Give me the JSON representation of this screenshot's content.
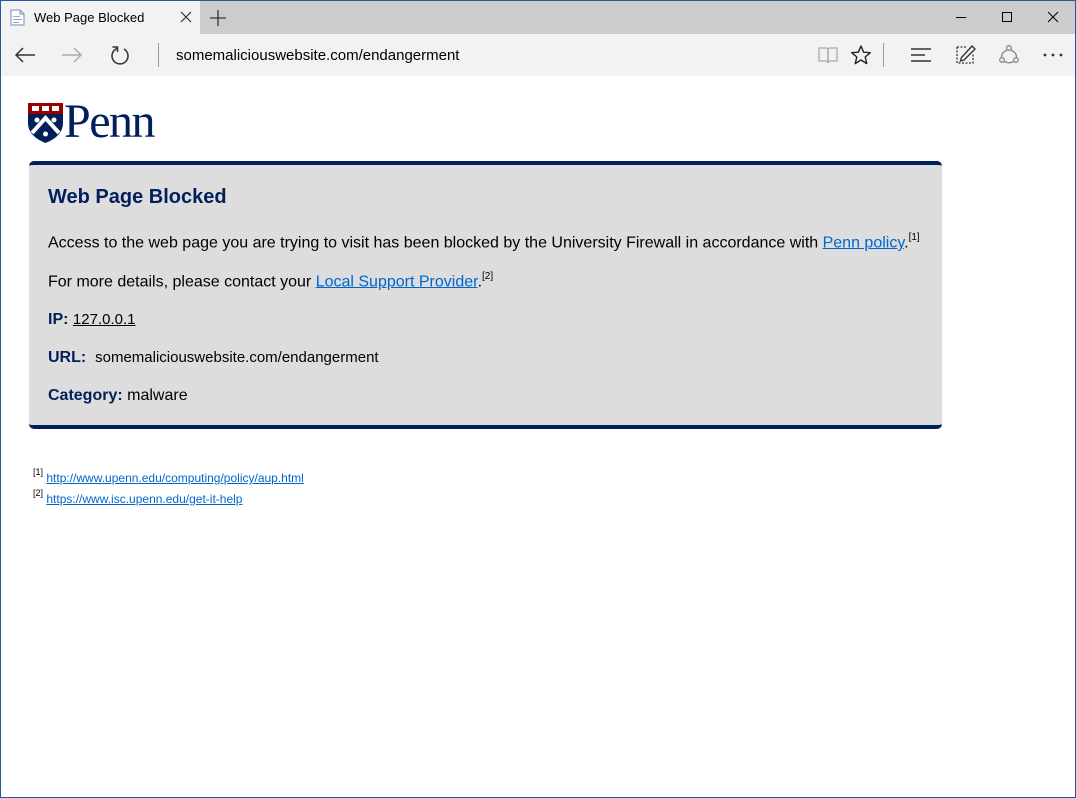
{
  "tab": {
    "title": "Web Page Blocked",
    "new_tab": "+"
  },
  "address_bar": {
    "url": "somemaliciouswebsite.com/endangerment"
  },
  "panel": {
    "title": "Web Page Blocked",
    "access_text": "Access to the web page you are trying to visit has been blocked by the University Firewall in accordance with ",
    "access_link": "Penn policy",
    "access_period": ".",
    "access_ref": "[1]",
    "contact_text": "For more details, please contact your ",
    "contact_link": "Local Support Provider",
    "contact_period": ".",
    "contact_ref": "[2]",
    "ip_label": "IP:",
    "ip_value": "127.0.0.1",
    "url_label": "URL:",
    "url_value": "somemaliciouswebsite.com/endangerment",
    "category_label": "Category:",
    "category_value": "malware"
  },
  "logo": {
    "text": "Penn"
  },
  "footnotes": [
    {
      "ref": "[1]",
      "url": "http://www.upenn.edu/computing/policy/aup.html"
    },
    {
      "ref": "[2]",
      "url": "https://www.isc.upenn.edu/get-it-help"
    }
  ],
  "colors": {
    "penn_blue": "#011f5b",
    "penn_red": "#990000",
    "link": "#0066cc",
    "panel_bg": "#dddddd"
  },
  "icons": [
    "page-favicon-icon",
    "close-icon",
    "plus-icon",
    "minimize-icon",
    "maximize-icon",
    "back-arrow-icon",
    "forward-arrow-icon",
    "refresh-icon",
    "reading-view-icon",
    "star-icon",
    "hub-icon",
    "web-note-icon",
    "share-icon",
    "more-icon",
    "penn-shield-icon"
  ]
}
